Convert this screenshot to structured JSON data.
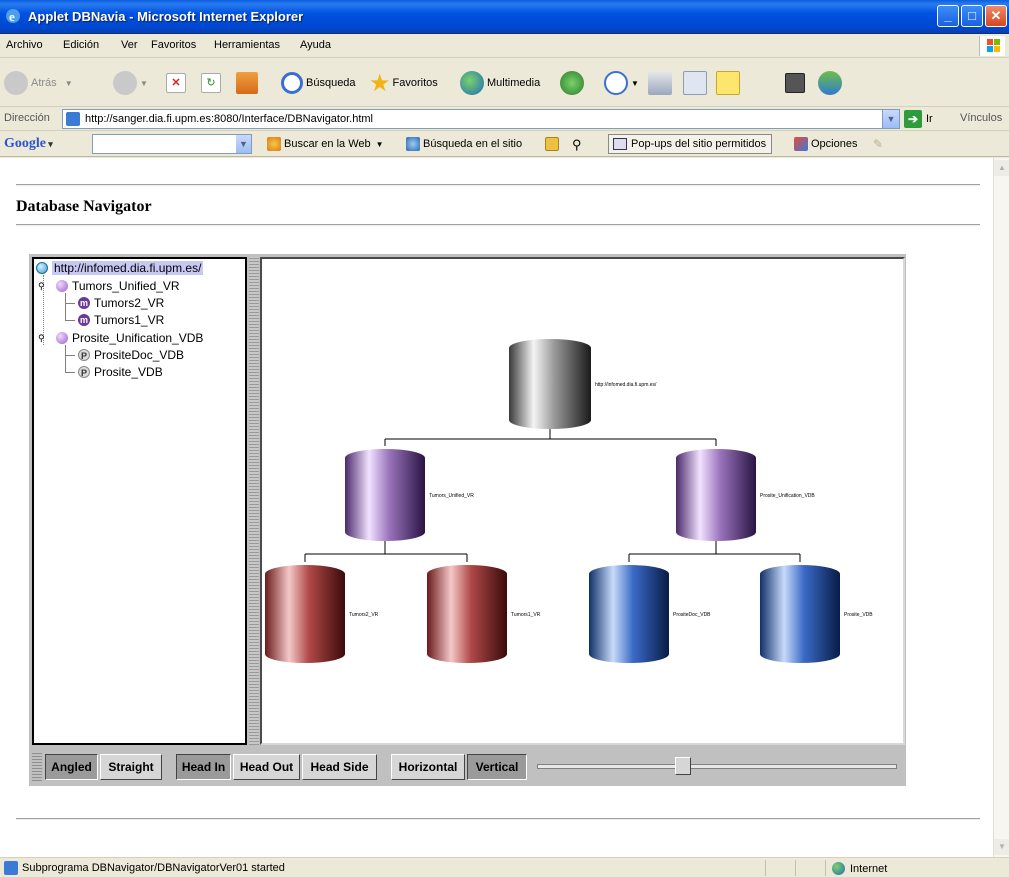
{
  "window": {
    "title": "Applet DBNavia - Microsoft Internet Explorer",
    "min": "_",
    "max": "□",
    "close": "✕"
  },
  "menu": [
    "Archivo",
    "Edición",
    "Ver",
    "Favoritos",
    "Herramientas",
    "Ayuda"
  ],
  "toolbar": {
    "back": "Atrás",
    "search": "Búsqueda",
    "favorites": "Favoritos",
    "multimedia": "Multimedia"
  },
  "address": {
    "label": "Dirección",
    "url": "http://sanger.dia.fi.upm.es:8080/Interface/DBNavigator.html",
    "go": "Ir",
    "links": "Vínculos"
  },
  "google": {
    "logo": "Google",
    "search_web": "Buscar en la Web",
    "search_site": "Búsqueda en el sitio",
    "popups": "Pop-ups del sitio permitidos",
    "options": "Opciones"
  },
  "page": {
    "title": "Database Navigator"
  },
  "tree": {
    "root": "http://infomed.dia.fi.upm.es/",
    "groups": [
      {
        "label": "Tumors_Unified_VR",
        "children": [
          "Tumors2_VR",
          "Tumors1_VR"
        ],
        "badge": "m"
      },
      {
        "label": "Prosite_Unification_VDB",
        "children": [
          "PrositeDoc_VDB",
          "Prosite_VDB"
        ],
        "badge": "P"
      }
    ]
  },
  "graph": {
    "root": {
      "label": "http://infomed.dia.fi.upm.es/",
      "color": "#8a8a8a"
    },
    "level1": [
      {
        "label": "Tumors_Unified_VR",
        "color": "#8a64a8"
      },
      {
        "label": "Prosite_Unification_VDB",
        "color": "#8a64a8"
      }
    ],
    "level2": [
      {
        "label": "Tumors2_VR",
        "color": "#a63a3a"
      },
      {
        "label": "Tumors1_VR",
        "color": "#a63a3a"
      },
      {
        "label": "PrositeDoc_VDB",
        "color": "#2f5db3"
      },
      {
        "label": "Prosite_VDB",
        "color": "#2f5db3"
      }
    ]
  },
  "controls": {
    "angled": "Angled",
    "straight": "Straight",
    "head_in": "Head In",
    "head_out": "Head Out",
    "head_side": "Head Side",
    "horizontal": "Horizontal",
    "vertical": "Vertical",
    "slider_value": 0.4
  },
  "status": {
    "message": "Subprograma DBNavigator/DBNavigatorVer01 started",
    "zone": "Internet"
  }
}
